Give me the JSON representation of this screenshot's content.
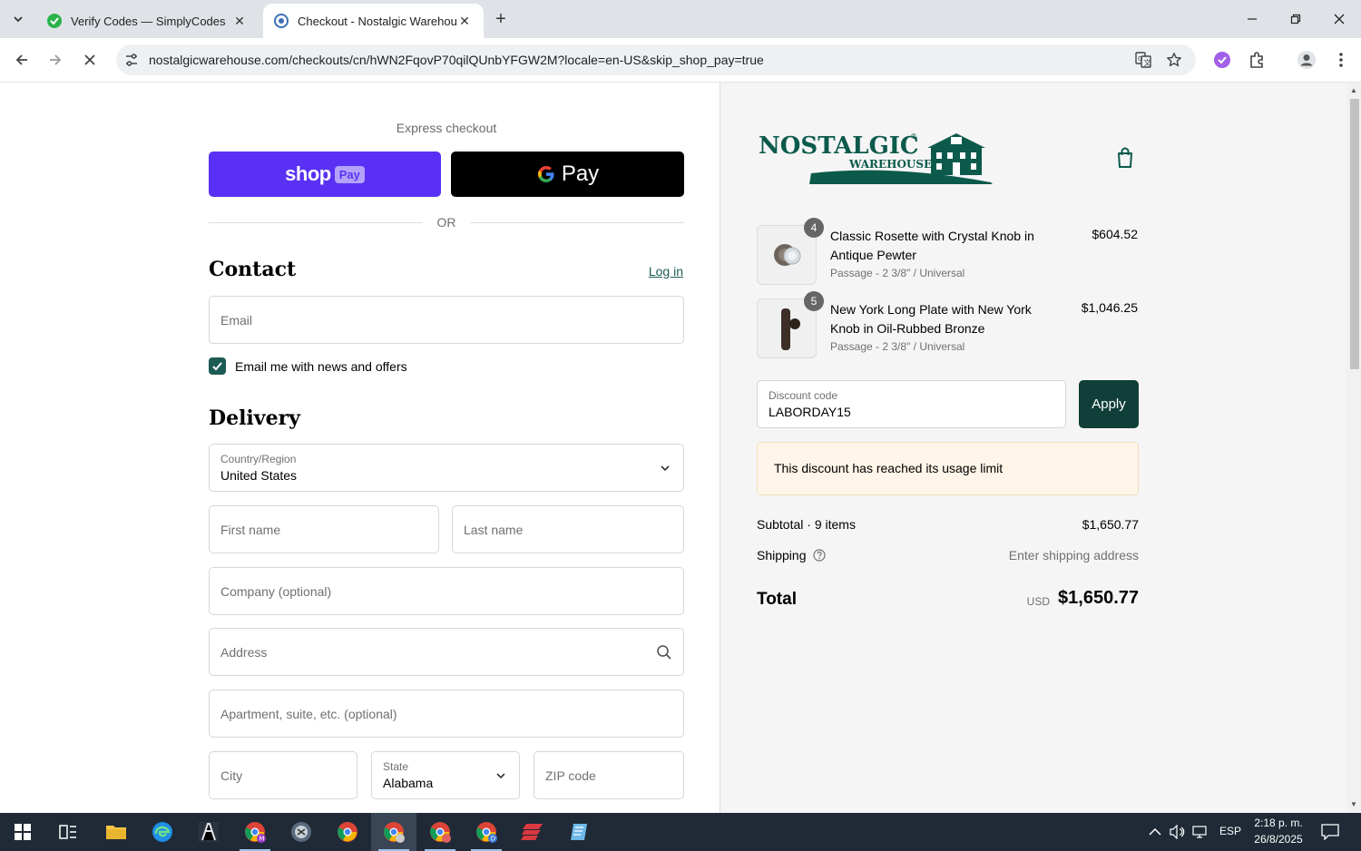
{
  "browser": {
    "tabs": [
      {
        "title": "Verify Codes — SimplyCodes",
        "active": false
      },
      {
        "title": "Checkout - Nostalgic Warehouse",
        "active": true
      }
    ],
    "url": "nostalgicwarehouse.com/checkouts/cn/hWN2FqovP70qilQUnbYFGW2M?locale=en-US&skip_shop_pay=true"
  },
  "checkout": {
    "express_label": "Express checkout",
    "shop_pay": {
      "word": "shop",
      "badge": "Pay"
    },
    "gpay": {
      "word": "Pay"
    },
    "or_label": "OR",
    "contact": {
      "title": "Contact",
      "login": "Log in",
      "email_placeholder": "Email",
      "news_label": "Email me with news and offers",
      "news_checked": true
    },
    "delivery": {
      "title": "Delivery",
      "country_label": "Country/Region",
      "country_value": "United States",
      "first_name": "First name",
      "last_name": "Last name",
      "company": "Company (optional)",
      "address": "Address",
      "apartment": "Apartment, suite, etc. (optional)",
      "city": "City",
      "state_label": "State",
      "state_value": "Alabama",
      "zip": "ZIP code"
    }
  },
  "summary": {
    "brand": {
      "line1": "NOSTALGIC",
      "reg": "®",
      "line2": "WAREHOUSE"
    },
    "items": [
      {
        "qty": "4",
        "name": "Classic Rosette with Crystal Knob in Antique Pewter",
        "variant": "Passage - 2 3/8\" / Universal",
        "price": "$604.52"
      },
      {
        "qty": "5",
        "name": "New York Long Plate with New York Knob in Oil-Rubbed Bronze",
        "variant": "Passage - 2 3/8\" / Universal",
        "price": "$1,046.25"
      }
    ],
    "discount_label": "Discount code",
    "discount_value": "LABORDAY15",
    "apply": "Apply",
    "notice": "This discount has reached its usage limit",
    "subtotal_label": "Subtotal",
    "subtotal_items": "9 items",
    "subtotal_value": "$1,650.77",
    "shipping_label": "Shipping",
    "shipping_value": "Enter shipping address",
    "total_label": "Total",
    "total_currency": "USD",
    "total_value": "$1,650.77"
  },
  "taskbar": {
    "lang": "ESP",
    "time": "2:18 p. m.",
    "date": "26/8/2025"
  },
  "colors": {
    "accent": "#1c5c54",
    "apply_bg": "#0f3f38",
    "shop_pay": "#5a31f4",
    "notice_bg": "#fff5e9"
  }
}
